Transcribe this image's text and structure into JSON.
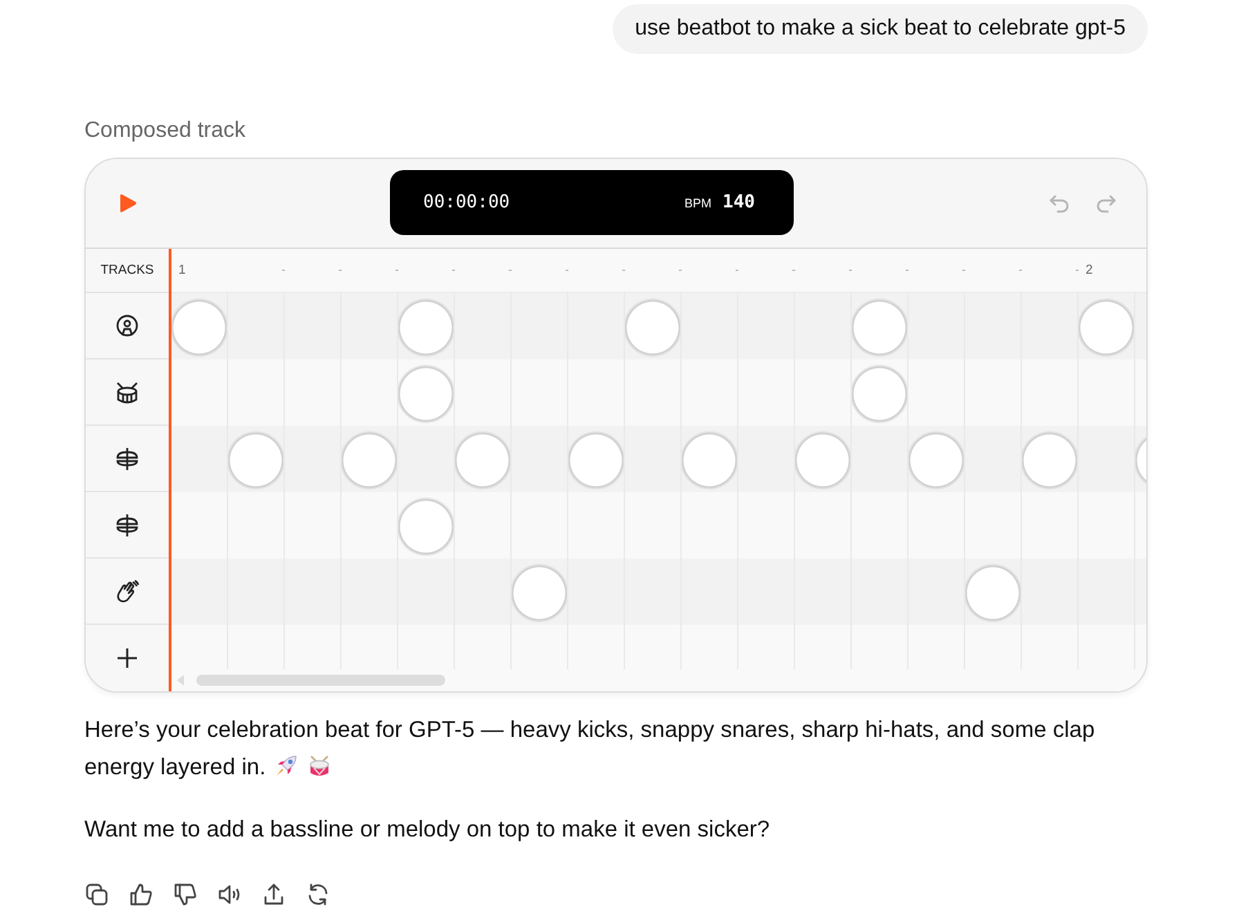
{
  "user_message": "use beatbot to make a sick beat to celebrate gpt-5",
  "section_label": "Composed track",
  "player": {
    "playing": false,
    "time": "00:00:00",
    "bpm_label": "BPM",
    "bpm": "140",
    "history": [
      {
        "kind": "undo",
        "disabled": true
      },
      {
        "kind": "redo",
        "disabled": true
      }
    ]
  },
  "tracks_heading": "TRACKS",
  "bars": [
    {
      "label": "1"
    },
    {
      "label": "2"
    }
  ],
  "tracks": [
    {
      "kind": "kick",
      "steps": [
        true,
        false,
        false,
        false,
        true,
        false,
        false,
        false,
        true,
        false,
        false,
        false,
        true,
        false,
        false,
        false,
        true,
        false
      ]
    },
    {
      "kind": "snare",
      "steps": [
        false,
        false,
        false,
        false,
        true,
        false,
        false,
        false,
        false,
        false,
        false,
        false,
        true,
        false,
        false,
        false,
        false,
        false
      ]
    },
    {
      "kind": "hihat",
      "steps": [
        false,
        true,
        false,
        true,
        false,
        true,
        false,
        true,
        false,
        true,
        false,
        true,
        false,
        true,
        false,
        true,
        false,
        true
      ]
    },
    {
      "kind": "hihat",
      "steps": [
        false,
        false,
        false,
        false,
        true,
        false,
        false,
        false,
        false,
        false,
        false,
        false,
        false,
        false,
        false,
        false,
        false,
        false
      ]
    },
    {
      "kind": "clap",
      "steps": [
        false,
        false,
        false,
        false,
        false,
        false,
        true,
        false,
        false,
        false,
        false,
        false,
        false,
        false,
        true,
        false,
        false,
        false
      ]
    }
  ],
  "paragraphs": [
    {
      "text": "Here’s your celebration beat for GPT-5 — heavy kicks, snappy snares, sharp hi-hats, and some clap energy layered in."
    },
    {
      "text": "Want me to add a bassline or melody on top to make it even sicker?"
    }
  ]
}
